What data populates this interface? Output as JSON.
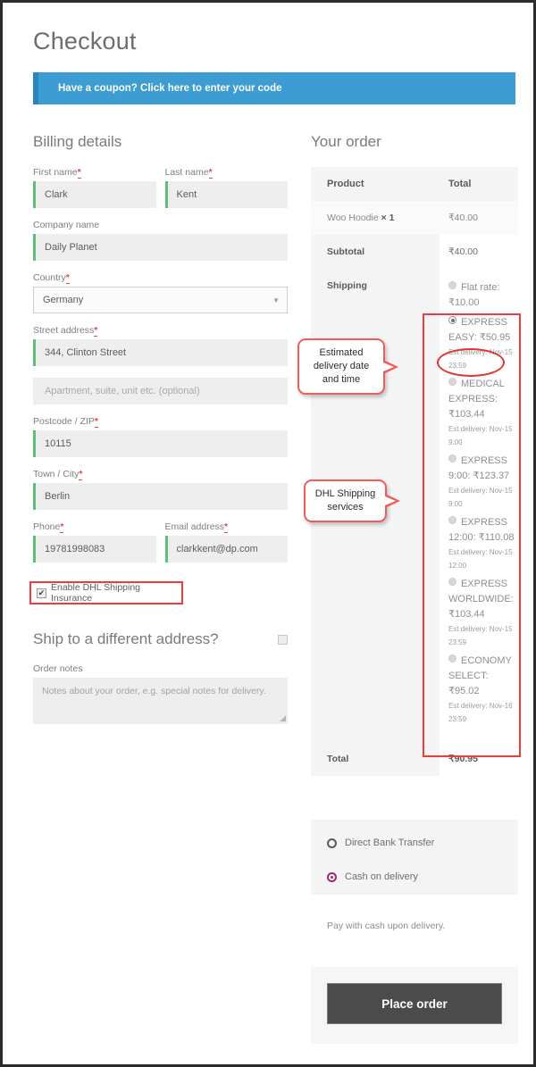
{
  "page": {
    "title": "Checkout"
  },
  "coupon": {
    "text": "Have a coupon? Click here to enter your code"
  },
  "billing": {
    "heading": "Billing details",
    "fields": [
      {
        "label": "First name",
        "required": true,
        "value": "Clark",
        "placeholder": ""
      },
      {
        "label": "Last name",
        "required": true,
        "value": "Kent",
        "placeholder": ""
      },
      {
        "label": "Company name",
        "required": false,
        "value": "Daily Planet",
        "placeholder": ""
      },
      {
        "label": "Country",
        "required": true,
        "value": "Germany",
        "placeholder": ""
      },
      {
        "label": "Street address",
        "required": true,
        "value": "344, Clinton Street",
        "placeholder": ""
      },
      {
        "label": "",
        "required": false,
        "value": "",
        "placeholder": "Apartment, suite, unit etc. (optional)"
      },
      {
        "label": "Postcode / ZIP",
        "required": true,
        "value": "10115",
        "placeholder": ""
      },
      {
        "label": "Town / City",
        "required": true,
        "value": "Berlin",
        "placeholder": ""
      },
      {
        "label": "Phone",
        "required": true,
        "value": "19781998083",
        "placeholder": ""
      },
      {
        "label": "Email address",
        "required": true,
        "value": "clarkkent@dp.com",
        "placeholder": ""
      }
    ],
    "dhl_insurance": {
      "label": "Enable DHL Shipping Insurance",
      "checked": true,
      "check_glyph": "✔"
    },
    "ship_different": {
      "label": "Ship to a different address?",
      "checked": false
    },
    "order_notes": {
      "label": "Order notes",
      "value": "",
      "placeholder": "Notes about your order, e.g. special notes for delivery."
    }
  },
  "order": {
    "heading": "Your order",
    "columns": {
      "product": "Product",
      "total": "Total"
    },
    "line_item": {
      "name": "Woo Hoodie",
      "qty": "× 1",
      "total": "₹40.00"
    },
    "subtotal": {
      "label": "Subtotal",
      "value": "₹40.00"
    },
    "shipping": {
      "label": "Shipping"
    },
    "shipping_methods": [
      {
        "name": "Flat rate:",
        "price": "₹10.00",
        "eta": "",
        "selected": false
      },
      {
        "name": "EXPRESS EASY:",
        "price": "₹50.95",
        "eta": "Est delivery: Nov-15 23:59",
        "selected": true
      },
      {
        "name": "MEDICAL EXPRESS:",
        "price": "₹103.44",
        "eta": "Est delivery: Nov-15 9:00",
        "selected": false
      },
      {
        "name": "EXPRESS 9:00:",
        "price": "₹123.37",
        "eta": "Est delivery: Nov-15 9:00",
        "selected": false
      },
      {
        "name": "EXPRESS 12:00:",
        "price": "₹110.08",
        "eta": "Est delivery: Nov-15 12:00",
        "selected": false
      },
      {
        "name": "EXPRESS WORLDWIDE:",
        "price": "₹103.44",
        "eta": "Est delivery: Nov-15 23:59",
        "selected": false
      },
      {
        "name": "ECONOMY SELECT:",
        "price": "₹95.02",
        "eta": "Est delivery: Nov-16 23:59",
        "selected": false
      }
    ],
    "total": {
      "label": "Total",
      "value": "₹90.95"
    }
  },
  "payment": {
    "methods": [
      {
        "label": "Direct Bank Transfer",
        "selected": false
      },
      {
        "label": "Cash on delivery",
        "selected": true
      }
    ],
    "description": "Pay with cash upon delivery.",
    "place_order_label": "Place order"
  },
  "annotations": [
    {
      "id": "callout-eta",
      "text": "Estimated delivery date and time"
    },
    {
      "id": "callout-dhl",
      "text": "DHL Shipping services"
    }
  ],
  "colors": {
    "coupon_blue": "#3d9cd2",
    "annotation_red": "#ec3c3c",
    "valid_field_green": "#5fbf7a",
    "required_red": "#e04a4a",
    "selected_payment": "#a0266f",
    "place_order_bg": "#4b4b4b"
  }
}
